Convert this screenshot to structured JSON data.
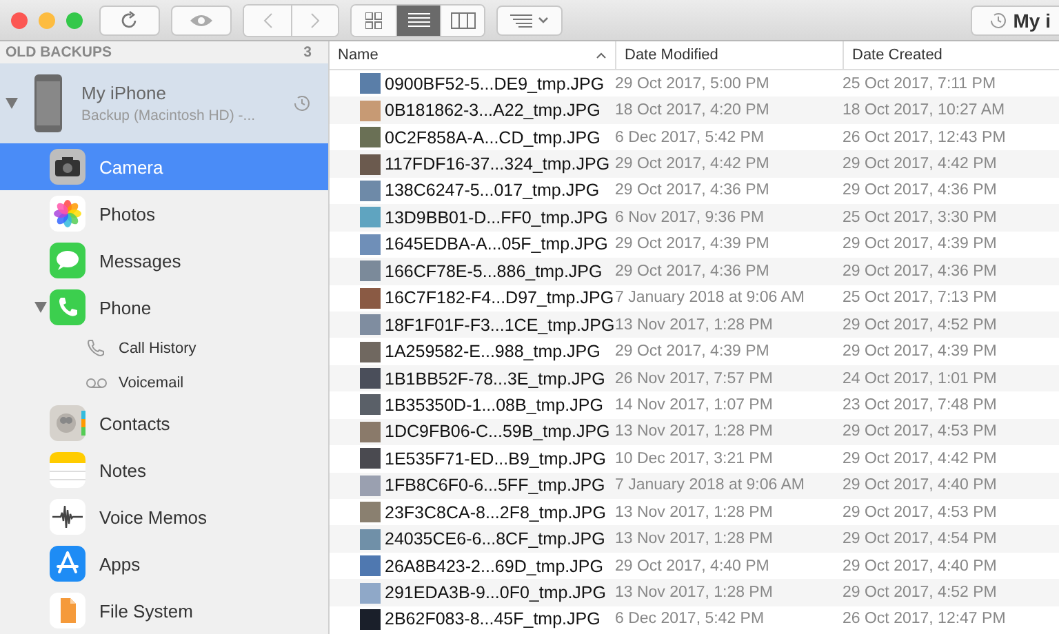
{
  "toolbar": {
    "view_modes": [
      {
        "kind": "icons",
        "selected": false
      },
      {
        "kind": "list",
        "selected": true
      },
      {
        "kind": "columns",
        "selected": false
      }
    ],
    "device_button": "My i"
  },
  "sidebar": {
    "section": {
      "title": "OLD BACKUPS",
      "count": "3"
    },
    "device": {
      "name": "My iPhone",
      "subtitle": "Backup (Macintosh HD) -...",
      "expanded": true
    },
    "items": [
      {
        "label": "Camera",
        "selected": true
      },
      {
        "label": "Photos",
        "selected": false
      },
      {
        "label": "Messages",
        "selected": false
      },
      {
        "label": "Phone",
        "selected": false,
        "expanded": true,
        "children": [
          {
            "label": "Call History",
            "selected": false
          },
          {
            "label": "Voicemail",
            "selected": false
          }
        ]
      },
      {
        "label": "Contacts",
        "selected": false
      },
      {
        "label": "Notes",
        "selected": false
      },
      {
        "label": "Voice Memos",
        "selected": false
      },
      {
        "label": "Apps",
        "selected": false
      },
      {
        "label": "File System",
        "selected": false
      }
    ]
  },
  "table": {
    "columns": [
      {
        "label": "Name",
        "sorted": true
      },
      {
        "label": "Date Modified",
        "sorted": false
      },
      {
        "label": "Date Created",
        "sorted": false
      }
    ],
    "rows": [
      [
        "0900BF52-5...DE9_tmp.JPG",
        "29 Oct 2017, 5:00 PM",
        "25 Oct 2017, 7:11 PM"
      ],
      [
        "0B181862-3...A22_tmp.JPG",
        "18 Oct 2017, 4:20 PM",
        "18 Oct 2017, 10:27 AM"
      ],
      [
        "0C2F858A-A...CD_tmp.JPG",
        "6 Dec 2017, 5:42 PM",
        "26 Oct 2017, 12:43 PM"
      ],
      [
        "117FDF16-37...324_tmp.JPG",
        "29 Oct 2017, 4:42 PM",
        "29 Oct 2017, 4:42 PM"
      ],
      [
        "138C6247-5...017_tmp.JPG",
        "29 Oct 2017, 4:36 PM",
        "29 Oct 2017, 4:36 PM"
      ],
      [
        "13D9BB01-D...FF0_tmp.JPG",
        "6 Nov 2017, 9:36 PM",
        "25 Oct 2017, 3:30 PM"
      ],
      [
        "1645EDBA-A...05F_tmp.JPG",
        "29 Oct 2017, 4:39 PM",
        "29 Oct 2017, 4:39 PM"
      ],
      [
        "166CF78E-5...886_tmp.JPG",
        "29 Oct 2017, 4:36 PM",
        "29 Oct 2017, 4:36 PM"
      ],
      [
        "16C7F182-F4...D97_tmp.JPG",
        "7 January 2018 at 9:06 AM",
        "25 Oct 2017, 7:13 PM"
      ],
      [
        "18F1F01F-F3...1CE_tmp.JPG",
        "13 Nov 2017, 1:28 PM",
        "29 Oct 2017, 4:52 PM"
      ],
      [
        "1A259582-E...988_tmp.JPG",
        "29 Oct 2017, 4:39 PM",
        "29 Oct 2017, 4:39 PM"
      ],
      [
        "1B1BB52F-78...3E_tmp.JPG",
        "26 Nov 2017, 7:57 PM",
        "24 Oct 2017, 1:01 PM"
      ],
      [
        "1B35350D-1...08B_tmp.JPG",
        "14 Nov 2017, 1:07 PM",
        "23 Oct 2017, 7:48 PM"
      ],
      [
        "1DC9FB06-C...59B_tmp.JPG",
        "13 Nov 2017, 1:28 PM",
        "29 Oct 2017, 4:53 PM"
      ],
      [
        "1E535F71-ED...B9_tmp.JPG",
        "10 Dec 2017, 3:21 PM",
        "29 Oct 2017, 4:42 PM"
      ],
      [
        "1FB8C6F0-6...5FF_tmp.JPG",
        "7 January 2018 at 9:06 AM",
        "29 Oct 2017, 4:40 PM"
      ],
      [
        "23F3C8CA-8...2F8_tmp.JPG",
        "13 Nov 2017, 1:28 PM",
        "29 Oct 2017, 4:53 PM"
      ],
      [
        "24035CE6-6...8CF_tmp.JPG",
        "13 Nov 2017, 1:28 PM",
        "29 Oct 2017, 4:54 PM"
      ],
      [
        "26A8B423-2...69D_tmp.JPG",
        "29 Oct 2017, 4:40 PM",
        "29 Oct 2017, 4:40 PM"
      ],
      [
        "291EDA3B-9...0F0_tmp.JPG",
        "13 Nov 2017, 1:28 PM",
        "29 Oct 2017, 4:52 PM"
      ],
      [
        "2B62F083-8...45F_tmp.JPG",
        "6 Dec 2017, 5:42 PM",
        "26 Oct 2017, 12:47 PM"
      ]
    ]
  }
}
